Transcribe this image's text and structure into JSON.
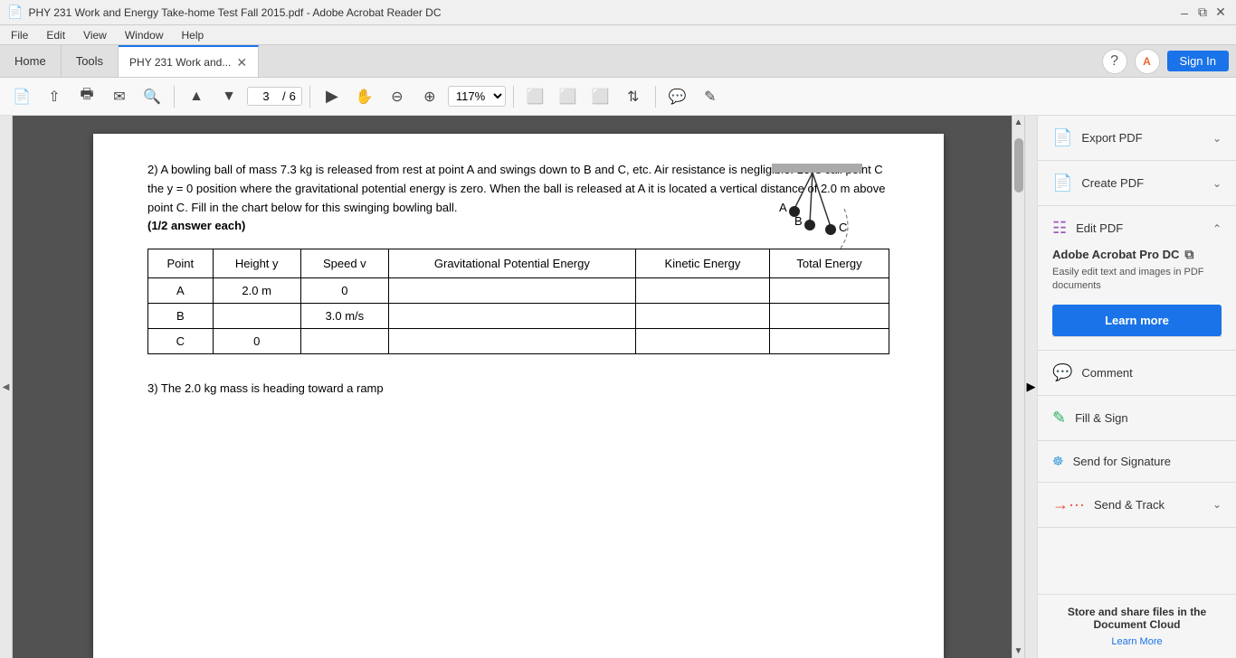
{
  "titlebar": {
    "title": "PHY 231 Work and Energy Take-home Test Fall 2015.pdf - Adobe Acrobat Reader DC",
    "pdf_icon": "📄",
    "minimize": "–",
    "maximize": "⧉",
    "close": "✕"
  },
  "menubar": {
    "items": [
      "File",
      "Edit",
      "View",
      "Window",
      "Help"
    ]
  },
  "tabs": {
    "home": "Home",
    "tools": "Tools",
    "active": "PHY 231 Work and...",
    "close": "✕"
  },
  "tabbar_right": {
    "help_icon": "?",
    "adobe_icon": "A",
    "signin": "Sign In"
  },
  "toolbar": {
    "page_current": "3",
    "page_total": "6",
    "zoom": "117%"
  },
  "pdf": {
    "problem": "2) A bowling ball of mass 7.3 kg is released from rest at point A and swings down to B and C, etc.  Air resistance is negligible. Let’s call point C the y = 0 position where the gravitational potential energy is zero. When the ball is released at A it is located a vertical distance of 2.0 m above point C. Fill in the chart below for this swinging bowling ball.",
    "bold_note": "(1/2 answer each)",
    "table": {
      "headers": [
        "Point",
        "Height y",
        "Speed v",
        "Gravitational Potential Energy",
        "Kinetic Energy",
        "Total Energy"
      ],
      "rows": [
        [
          "A",
          "2.0 m",
          "0",
          "",
          "",
          ""
        ],
        [
          "B",
          "",
          "3.0 m/s",
          "",
          "",
          ""
        ],
        [
          "C",
          "0",
          "",
          "",
          "",
          ""
        ]
      ]
    },
    "bottom_text": "3) The 2.0 kg mass is heading toward a ramp"
  },
  "diagram": {
    "label_a": "A",
    "label_b": "B",
    "label_c": "C"
  },
  "sidebar": {
    "export_pdf": "Export PDF",
    "create_pdf": "Create PDF",
    "edit_pdf": "Edit PDF",
    "promo_title": "Adobe Acrobat Pro DC",
    "promo_desc": "Easily edit text and images in PDF documents",
    "learn_more": "Learn more",
    "comment": "Comment",
    "fill_sign": "Fill & Sign",
    "send_signature": "Send for Signature",
    "send_track": "Send & Track",
    "store_title": "Store and share files in the Document Cloud",
    "store_link": "Learn More"
  }
}
